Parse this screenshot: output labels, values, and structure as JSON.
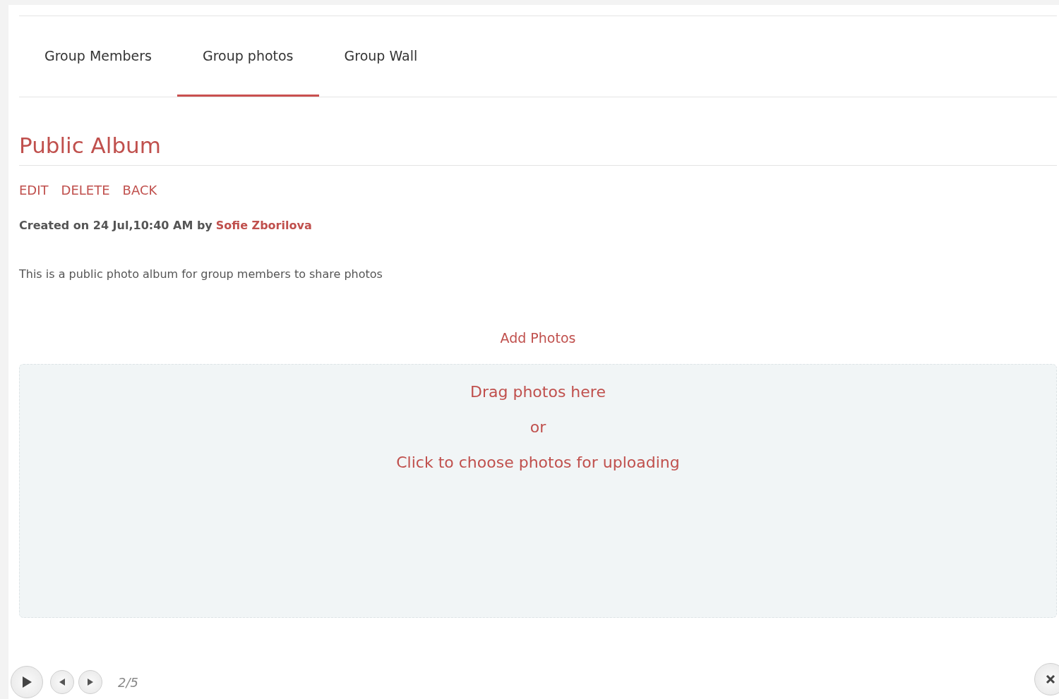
{
  "tabs": [
    {
      "label": "Group Members",
      "selected": false
    },
    {
      "label": "Group photos",
      "selected": true
    },
    {
      "label": "Group Wall",
      "selected": false
    }
  ],
  "album": {
    "title": "Public Album",
    "actions": [
      "EDIT",
      "DELETE",
      "BACK"
    ],
    "created": "Created on 24 Jul,10:40 AM by",
    "author": "Sofie Zborilova",
    "description": "This is a public photo album for group members to share photos"
  },
  "add_photos": "Add Photos",
  "dropzone": {
    "lines": [
      "Drag photos here",
      "or",
      "Click to choose photos for uploading"
    ]
  },
  "slideshow": {
    "counter": "2/5"
  }
}
